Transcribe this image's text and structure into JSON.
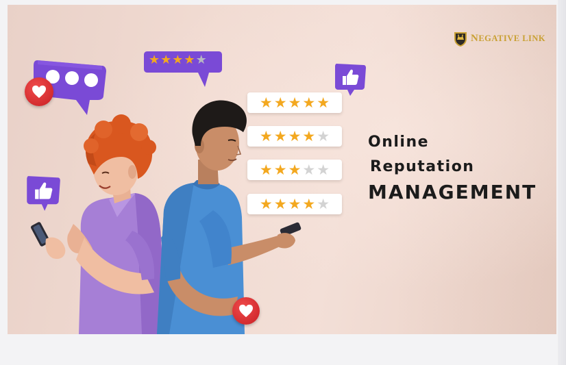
{
  "banner": {
    "headline": {
      "line1": "Online",
      "line2": "Reputation",
      "line3": "MANAGEMENT"
    },
    "logo": {
      "text": "Negative Link",
      "icon": "crown-shield-icon"
    },
    "rating_cards": [
      {
        "filled": 5,
        "total": 5
      },
      {
        "filled": 4,
        "total": 5
      },
      {
        "filled": 3,
        "total": 5
      },
      {
        "filled": 4,
        "total": 5
      }
    ],
    "star_bubble": {
      "filled": 4,
      "total": 5
    },
    "colors": {
      "star_on": "#f3a81f",
      "star_off": "#d3d3d3",
      "bubble_purple": "#7a4ad6",
      "heart_red": "#d62b2f",
      "woman_shirt": "#a67fd6",
      "man_shirt": "#4a8fd4",
      "woman_hair": "#d9571f"
    },
    "icons": [
      "chat-dots-icon",
      "star-rating-bubble-icon",
      "thumbs-up-icon",
      "heart-icon"
    ]
  }
}
